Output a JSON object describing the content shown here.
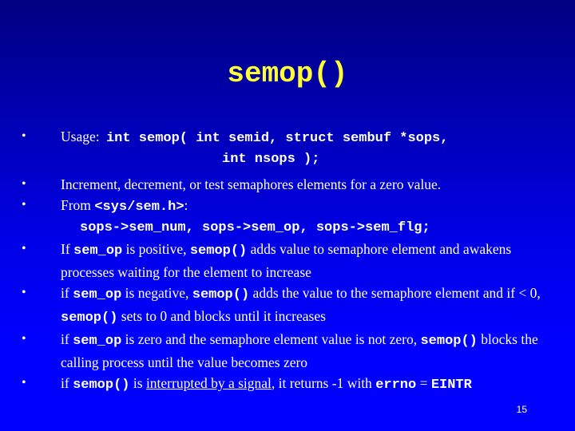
{
  "slide": {
    "title": "semop()",
    "page_number": "15",
    "colors": {
      "background_top": "#000080",
      "background_bottom": "#0000FF",
      "title": "#FFFF33",
      "text": "#FFFFFF"
    },
    "bullet_glyph": "•",
    "bullets": [
      {
        "usage_label": "Usage:",
        "code_line1": "int semop( int semid, struct sembuf *sops,",
        "code_line2": "int nsops );"
      },
      {
        "text": "Increment, decrement, or test semaphores elements for a zero value."
      },
      {
        "prefix": "From ",
        "code_header": "<sys/sem.h>",
        "suffix": ":",
        "code_line": "sops->sem_num, sops->sem_op, sops->sem_flg;"
      },
      {
        "t1": "If ",
        "c1": "sem_op",
        "t2": " is positive, ",
        "c2": "semop()",
        "t3": " adds value to semaphore element and awakens processes waiting for the element to increase"
      },
      {
        "t1": "if ",
        "c1": "sem_op",
        "t2": " is negative, ",
        "c2": "semop()",
        "t3": " adds the value to the semaphore element and if < 0, ",
        "c3": "semop()",
        "t4": " sets to 0 and blocks until it increases"
      },
      {
        "t1": "if ",
        "c1": "sem_op",
        "t2": " is zero and the semaphore element value is not zero, ",
        "c2": "semop()",
        "t3": " blocks the calling process until the value becomes zero"
      },
      {
        "t1": "if ",
        "c1": "semop()",
        "t2": " is ",
        "link": "interrupted by a signal",
        "t3": ", it returns -1 with ",
        "c2": "errno",
        "t4": " = ",
        "c3": "EINTR"
      }
    ]
  }
}
